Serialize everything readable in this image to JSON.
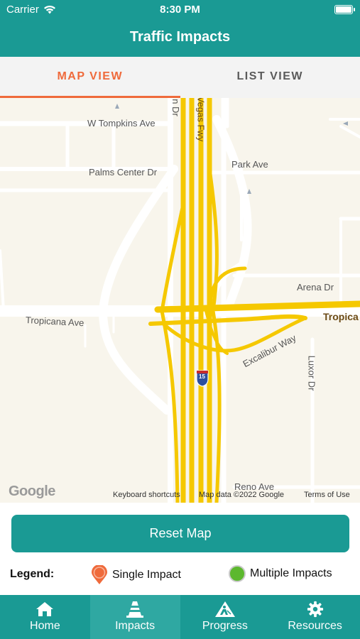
{
  "status_bar": {
    "carrier": "Carrier",
    "time": "8:30 PM"
  },
  "header": {
    "title": "Traffic Impacts"
  },
  "tabs": [
    {
      "label": "MAP VIEW",
      "active": true
    },
    {
      "label": "LIST VIEW",
      "active": false
    }
  ],
  "map": {
    "labels": {
      "tompkins": "W Tompkins Ave",
      "palms": "Palms Center Dr",
      "park": "Park Ave",
      "vegas_fwy": "Vegas Fwy",
      "n_dr": "n Dr",
      "arena": "Arena Dr",
      "tropicana_left": "Tropicana Ave",
      "tropicana_right": "Tropica",
      "excalibur": "Excalibur Way",
      "luxor": "Luxor Dr",
      "reno": "Reno Ave",
      "shield": "15"
    },
    "google_logo": "Google",
    "footer": {
      "shortcuts": "Keyboard shortcuts",
      "map_data": "Map data ©2022 Google",
      "terms": "Terms of Use"
    }
  },
  "reset_button": {
    "label": "Reset Map"
  },
  "legend": {
    "label": "Legend:",
    "single": {
      "label": "Single Impact",
      "color": "#ef6a3b"
    },
    "multiple": {
      "label": "Multiple Impacts",
      "color": "#5cb82e"
    }
  },
  "bottom_nav": {
    "items": [
      {
        "label": "Home",
        "icon": "home-icon",
        "active": false
      },
      {
        "label": "Impacts",
        "icon": "traffic-cone-icon",
        "active": true
      },
      {
        "label": "Progress",
        "icon": "construction-icon",
        "active": false
      },
      {
        "label": "Resources",
        "icon": "gear-icon",
        "active": false
      }
    ]
  },
  "colors": {
    "primary": "#1a9a94",
    "accent": "#ef6a3b",
    "impact_highlight": "#f5c800"
  }
}
